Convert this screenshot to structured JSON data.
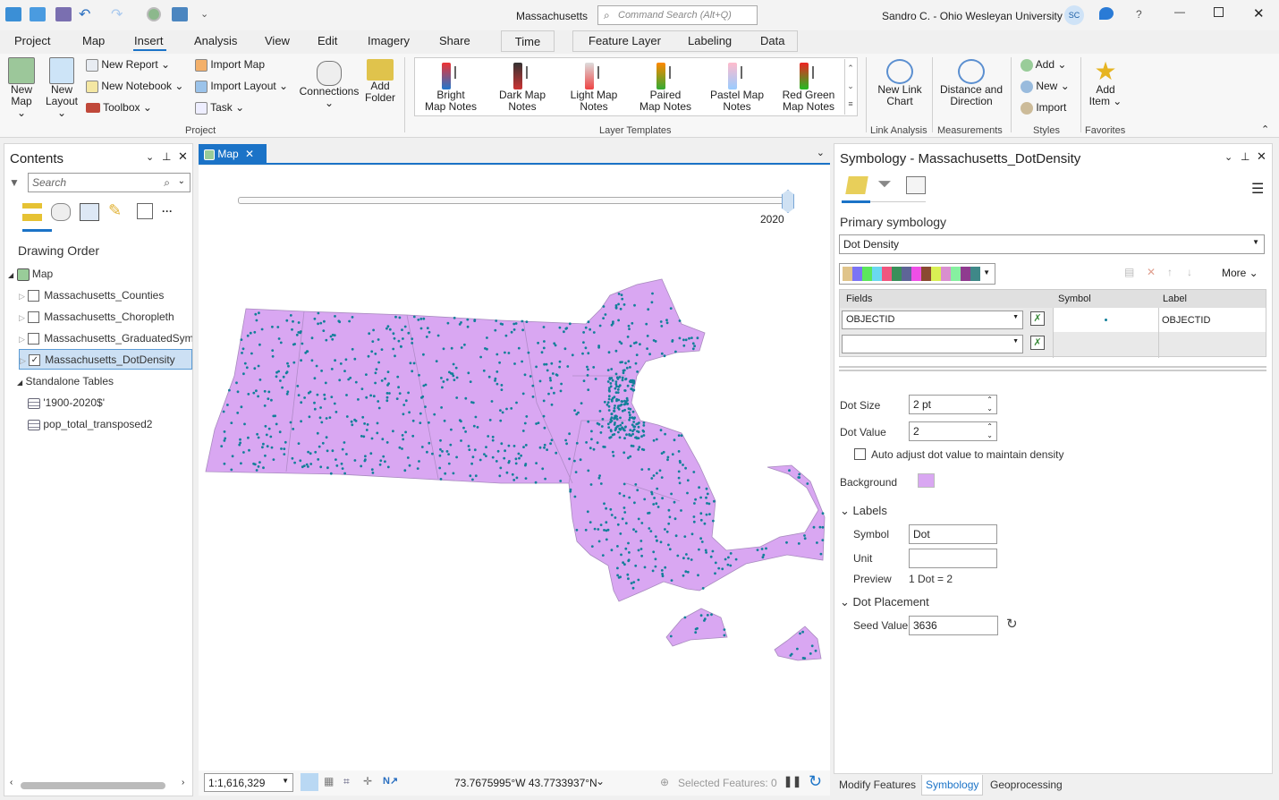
{
  "title_bar": {
    "project": "Massachusetts",
    "command_search_placeholder": "Command Search (Alt+Q)",
    "user": "Sandro C. - Ohio Wesleyan University",
    "user_initials": "SC"
  },
  "menu_tabs": [
    "Project",
    "Map",
    "Insert",
    "Analysis",
    "View",
    "Edit",
    "Imagery",
    "Share",
    "Time",
    "Feature Layer",
    "Labeling",
    "Data"
  ],
  "active_tab": "Insert",
  "ribbon": {
    "project_group": {
      "label": "Project",
      "new_map": "New\nMap",
      "new_map_l1": "New",
      "new_map_l2": "Map",
      "new_layout_l1": "New",
      "new_layout_l2": "Layout",
      "new_report": "New Report",
      "new_notebook": "New Notebook",
      "toolbox": "Toolbox",
      "import_map": "Import Map",
      "import_layout": "Import Layout",
      "task": "Task",
      "connections": "Connections",
      "add_folder_l1": "Add",
      "add_folder_l2": "Folder"
    },
    "layer_templates": {
      "label": "Layer Templates",
      "items": [
        {
          "l1": "Bright",
          "l2": "Map Notes"
        },
        {
          "l1": "Dark Map",
          "l2": "Notes"
        },
        {
          "l1": "Light Map",
          "l2": "Notes"
        },
        {
          "l1": "Paired",
          "l2": "Map Notes"
        },
        {
          "l1": "Pastel Map",
          "l2": "Notes"
        },
        {
          "l1": "Red Green",
          "l2": "Map Notes"
        }
      ]
    },
    "link_analysis": {
      "label": "Link Analysis",
      "l1": "New Link",
      "l2": "Chart"
    },
    "measurements": {
      "label": "Measurements",
      "l1": "Distance and",
      "l2": "Direction"
    },
    "styles": {
      "label": "Styles",
      "add": "Add",
      "new": "New",
      "import": "Import"
    },
    "favorites": {
      "label": "Favorites",
      "l1": "Add",
      "l2": "Item"
    }
  },
  "contents": {
    "title": "Contents",
    "search_placeholder": "Search",
    "drawing_order": "Drawing Order",
    "map": "Map",
    "layers": [
      {
        "name": "Massachusetts_Counties",
        "checked": false
      },
      {
        "name": "Massachusetts_Choropleth",
        "checked": false
      },
      {
        "name": "Massachusetts_GraduatedSymb",
        "checked": false
      },
      {
        "name": "Massachusetts_DotDensity",
        "checked": true
      }
    ],
    "standalone_tables": "Standalone Tables",
    "tables": [
      "'1900-2020$'",
      "pop_total_transposed2"
    ]
  },
  "map_view": {
    "tab": "Map",
    "time_label": "2020",
    "scale": "1:1,616,329",
    "coordinates": "73.7675995°W 43.7733937°N",
    "selected_features": "Selected Features: 0",
    "fill_color": "#d9a7f2",
    "dot_color": "#127f99"
  },
  "symbology": {
    "title": "Symbology - Massachusetts_DotDensity",
    "primary_label": "Primary symbology",
    "primary_value": "Dot Density",
    "color_scheme": [
      "#e0c48a",
      "#7b74f5",
      "#5ce65c",
      "#6ad8f0",
      "#f0567e",
      "#3a8f5a",
      "#5e6597",
      "#ef4fe6",
      "#8a4a31",
      "#d9ef54",
      "#d98fcf",
      "#86f0a0",
      "#8f3b8f",
      "#3f8888"
    ],
    "more": "More",
    "col_fields": "Fields",
    "col_symbol": "Symbol",
    "col_label": "Label",
    "rows": [
      {
        "field": "OBJECTID",
        "label": "OBJECTID"
      },
      {
        "field": "",
        "label": ""
      }
    ],
    "dot_size_label": "Dot Size",
    "dot_size": "2 pt",
    "dot_value_label": "Dot Value",
    "dot_value": "2",
    "auto_adjust": "Auto adjust dot value to maintain density",
    "background_label": "Background",
    "background_color": "#d9a7f2",
    "labels_section": "Labels",
    "symbol_label": "Symbol",
    "symbol_value": "Dot",
    "unit_label": "Unit",
    "unit_value": "",
    "preview_label": "Preview",
    "preview_value": "1 Dot = 2",
    "placement_section": "Dot Placement",
    "seed_label": "Seed Value",
    "seed_value": "3636"
  },
  "bottom_tabs": [
    "Modify Features",
    "Symbology",
    "Geoprocessing"
  ]
}
